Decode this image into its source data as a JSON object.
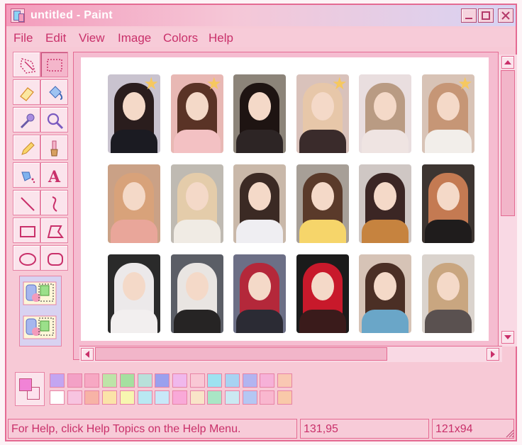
{
  "window": {
    "title": "untitled - Paint",
    "controls": [
      {
        "name": "minimize-button",
        "icon": "minimize-icon"
      },
      {
        "name": "maximize-button",
        "icon": "maximize-icon"
      },
      {
        "name": "close-button",
        "icon": "close-icon"
      }
    ]
  },
  "menu": [
    "File",
    "Edit",
    "View",
    "Image",
    "Colors",
    "Help"
  ],
  "tools": [
    {
      "name": "free-form-select",
      "icon": "lasso-select-icon",
      "active": false
    },
    {
      "name": "select",
      "icon": "rect-select-icon",
      "active": true
    },
    {
      "name": "eraser",
      "icon": "eraser-icon",
      "active": false
    },
    {
      "name": "fill",
      "icon": "paint-bucket-icon",
      "active": false
    },
    {
      "name": "pick-color",
      "icon": "eyedropper-icon",
      "active": false
    },
    {
      "name": "magnifier",
      "icon": "magnifier-icon",
      "active": false
    },
    {
      "name": "pencil",
      "icon": "pencil-icon",
      "active": false
    },
    {
      "name": "brush",
      "icon": "brush-icon",
      "active": false
    },
    {
      "name": "airbrush",
      "icon": "airbrush-icon",
      "active": false
    },
    {
      "name": "text",
      "icon": "text-icon",
      "active": false
    },
    {
      "name": "line",
      "icon": "line-icon",
      "active": false
    },
    {
      "name": "curve",
      "icon": "curve-icon",
      "active": false
    },
    {
      "name": "rectangle",
      "icon": "rectangle-icon",
      "active": false
    },
    {
      "name": "polygon",
      "icon": "polygon-icon",
      "active": false
    },
    {
      "name": "ellipse",
      "icon": "ellipse-icon",
      "active": false
    },
    {
      "name": "rounded-rectangle",
      "icon": "rounded-rectangle-icon",
      "active": false
    }
  ],
  "tool_options": [
    "opaque-selection-icon",
    "transparent-selection-icon"
  ],
  "photocards": [
    {
      "star": true,
      "hair": "#2a1d1d",
      "top": "#1b1b22",
      "bg": "#c9c3cf"
    },
    {
      "star": true,
      "hair": "#5a3326",
      "top": "#f3c1c3",
      "bg": "#e8b8b4"
    },
    {
      "star": false,
      "hair": "#1e1412",
      "top": "#2d2525",
      "bg": "#8c8479"
    },
    {
      "star": true,
      "hair": "#e7c7a9",
      "top": "#3a2b2b",
      "bg": "#d9c2bb"
    },
    {
      "star": false,
      "hair": "#b99b83",
      "top": "#efe4e2",
      "bg": "#e9dedf"
    },
    {
      "star": true,
      "hair": "#c69676",
      "top": "#f2eeea",
      "bg": "#d8c3b6"
    },
    {
      "star": false,
      "hair": "#d8a27a",
      "top": "#e9a69a",
      "bg": "#caa186"
    },
    {
      "star": false,
      "hair": "#e4ccaa",
      "top": "#f0ebe4",
      "bg": "#bfbab2"
    },
    {
      "star": false,
      "hair": "#3b2a24",
      "top": "#efeef2",
      "bg": "#c9b8a9"
    },
    {
      "star": false,
      "hair": "#5a3a2a",
      "top": "#f6d56a",
      "bg": "#a79f97"
    },
    {
      "star": false,
      "hair": "#3b2624",
      "top": "#c6833f",
      "bg": "#cfc7c4"
    },
    {
      "star": false,
      "hair": "#c47a52",
      "top": "#1f1c1c",
      "bg": "#3d3531"
    },
    {
      "star": false,
      "hair": "#ece9ea",
      "top": "#f2efef",
      "bg": "#2a2a2a"
    },
    {
      "star": false,
      "hair": "#e9e5e2",
      "top": "#262424",
      "bg": "#5b5e66"
    },
    {
      "star": false,
      "hair": "#b4283a",
      "top": "#2b2b34",
      "bg": "#6c6f86"
    },
    {
      "star": false,
      "hair": "#c8192b",
      "top": "#3a1b1b",
      "bg": "#1b1b1b"
    },
    {
      "star": false,
      "hair": "#4b2f25",
      "top": "#6aa6c8",
      "bg": "#d6c3b6"
    },
    {
      "star": false,
      "hair": "#c9a680",
      "top": "#5a5150",
      "bg": "#dad3cd"
    }
  ],
  "palette": {
    "foreground": "#f183d6",
    "background": "#fde2ee",
    "row1": [
      "#c3a5f1",
      "#f3a1c6",
      "#f7a8c3",
      "#bde4a8",
      "#a5e0a0",
      "#b8e0da",
      "#9aa0ee",
      "#f0b8ec",
      "#f9c8d5",
      "#9ee2f0",
      "#a7d3f2",
      "#b2b4f0",
      "#f6b1d8",
      "#f9c8b3"
    ],
    "row2": [
      "#ffffff",
      "#f7c4e0",
      "#f7b3a6",
      "#fbe3a8",
      "#f7f6b0",
      "#b9e8f2",
      "#c8e8f8",
      "#f9a9d8",
      "#f9e4c8",
      "#a9e6c5",
      "#cbe9f2",
      "#b4c7f3",
      "#f9b7cf",
      "#f9c9a9"
    ]
  },
  "status": {
    "help": "For Help, click Help Topics on the Help Menu.",
    "coordinates": "131,95",
    "selection_size": "121x94"
  },
  "colors": {
    "accent": "#e46a92",
    "text": "#c9306a",
    "window_bg": "#f7c9d6",
    "star": "#f6c85f"
  }
}
